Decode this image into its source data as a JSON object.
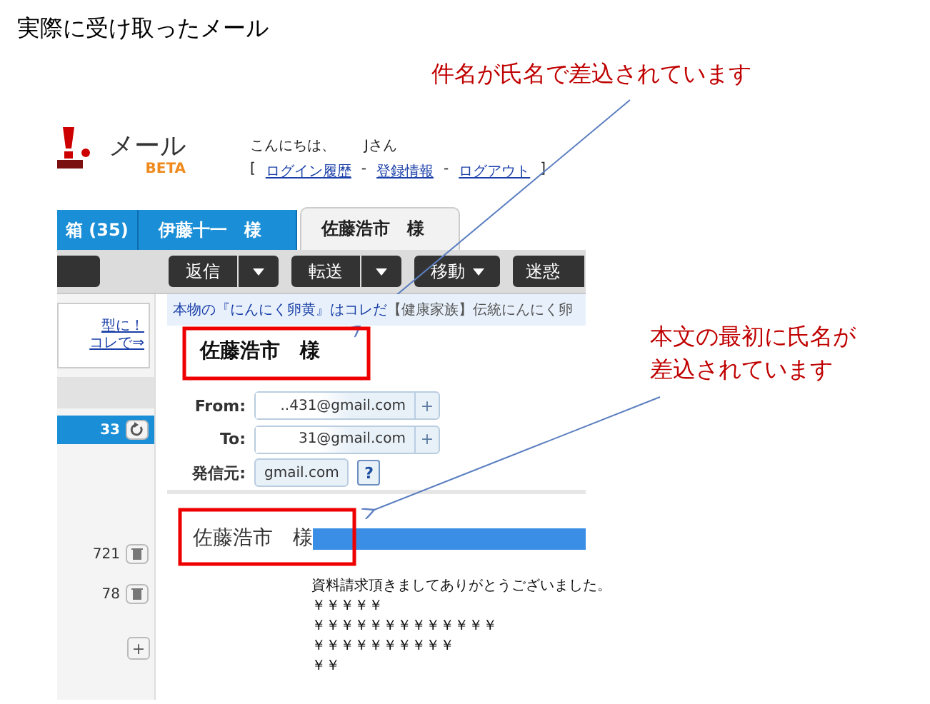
{
  "title": "実際に受け取ったメール",
  "annotations": [
    {
      "lines": [
        "件名が氏名で差込されています"
      ]
    },
    {
      "lines": [
        "本文の最初に氏名が",
        "差込されています"
      ]
    }
  ],
  "mail_screen": {
    "logo": {
      "text": "メール",
      "badge": "BETA"
    },
    "greeting": "こんにちは、　　Jさん",
    "account_links": {
      "open": "[",
      "separator": "-",
      "close": "]",
      "links": [
        "ログイン履歴",
        "登録情報",
        "ログアウト"
      ]
    },
    "tabs": [
      {
        "label": "箱 (35)",
        "selected": false
      },
      {
        "label": "伊藤十一　様",
        "selected": false
      },
      {
        "label": "佐藤浩市　様",
        "selected": true
      }
    ],
    "toolbar": [
      {
        "kind": "stub"
      },
      {
        "kind": "split",
        "label": "返信"
      },
      {
        "kind": "split",
        "label": "転送"
      },
      {
        "kind": "menu",
        "label": "移動"
      },
      {
        "kind": "plain",
        "label": "迷惑"
      }
    ],
    "ad_line": {
      "link": "本物の『にんにく卵黄』はコレだ",
      "text": "【健康家族】伝統にんにく卵"
    },
    "sidebar": {
      "ad_lines": [
        "型に！",
        "コレで⇒"
      ],
      "folders": [
        {
          "count": "33",
          "selected": true,
          "kind": "refresh"
        },
        {
          "count": "721",
          "selected": false,
          "kind": "trash"
        },
        {
          "count": "78",
          "selected": false,
          "kind": "trash"
        }
      ],
      "add": "+"
    },
    "subject": "佐藤浩市　様",
    "headers": [
      {
        "label": "From:",
        "value": "..431@gmail.com",
        "add": "+"
      },
      {
        "label": "To:",
        "value": "31@gmail.com",
        "add": "+"
      },
      {
        "label": "発信元:",
        "value": "gmail.com",
        "help": "?"
      }
    ],
    "body": {
      "salutation": "佐藤浩市　様",
      "lines": [
        "資料請求頂きましてありがとうございました。",
        "￥￥￥￥￥",
        "￥￥￥￥￥￥￥￥￥￥￥￥￥",
        "￥￥￥￥￥￥￥￥￥￥",
        "￥￥"
      ]
    }
  }
}
